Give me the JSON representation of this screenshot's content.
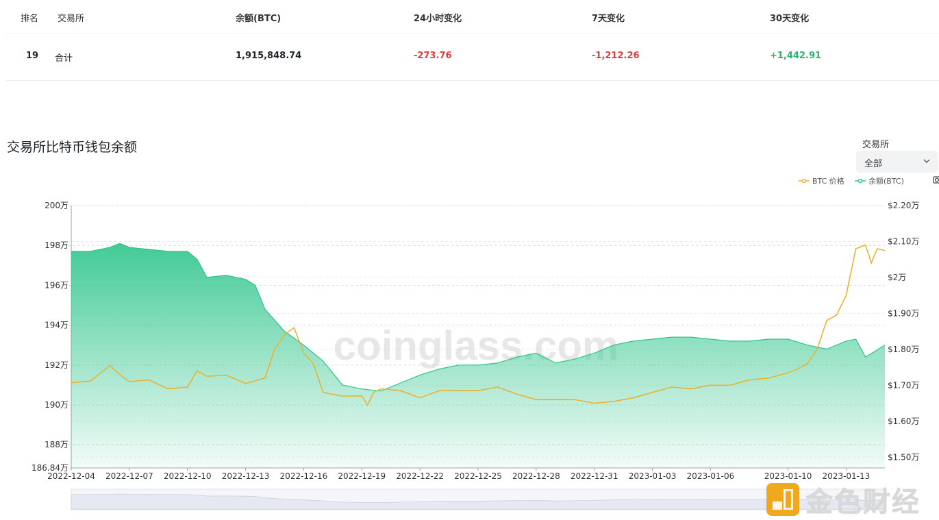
{
  "table": {
    "headers": {
      "rank": "排名",
      "exchange": "交易所",
      "balance": "余额(BTC)",
      "change_24h": "24小时变化",
      "change_7d": "7天变化",
      "change_30d": "30天变化"
    },
    "row": {
      "rank": "19",
      "exchange": "合计",
      "balance": "1,915,848.74",
      "change_24h": "-273.76",
      "change_7d": "-1,212.26",
      "change_30d": "+1,442.91"
    }
  },
  "chart_title": "交易所比特币钱包余额",
  "filter": {
    "label": "交易所",
    "selected": "全部"
  },
  "watermark": "coinglass.com",
  "brand": "金色财经",
  "colors": {
    "balance": "#2dc38a",
    "price": "#e9b234",
    "negative": "#e23c3c",
    "positive": "#2ab36a"
  },
  "icons": {
    "select": "chevron-down-icon",
    "toolbar": "camera-icon",
    "brand": "brand-logo-icon"
  },
  "chart_data": {
    "type": "area",
    "x_tick_labels": [
      "2022-12-04",
      "2022-12-07",
      "2022-12-10",
      "2022-12-13",
      "2022-12-16",
      "2022-12-19",
      "2022-12-22",
      "2022-12-25",
      "2022-12-28",
      "2022-12-31",
      "2023-01-03",
      "2023-01-06",
      "2023-01-10",
      "2023-01-13"
    ],
    "x_range": [
      "2022-12-04",
      "2023-01-15"
    ],
    "left_axis": {
      "ticks": [
        "200万",
        "198万",
        "196万",
        "194万",
        "192万",
        "190万",
        "188万",
        "186.84万"
      ],
      "min_wan": 186.84,
      "max_wan": 200
    },
    "right_axis": {
      "ticks": [
        "$2.20万",
        "$2.10万",
        "$2万",
        "$1.90万",
        "$1.80万",
        "$1.70万",
        "$1.60万",
        "$1.50万"
      ],
      "min_wan": 1.47,
      "max_wan": 2.2
    },
    "grid": true,
    "legend_position": "top-right",
    "series": [
      {
        "name": "BTC 价格",
        "axis": "right",
        "units": "万 USD",
        "points": [
          [
            "2022-12-04",
            1.707
          ],
          [
            "2022-12-05",
            1.712
          ],
          [
            "2022-12-06",
            1.755
          ],
          [
            "2022-12-06.5",
            1.73
          ],
          [
            "2022-12-07",
            1.71
          ],
          [
            "2022-12-08",
            1.715
          ],
          [
            "2022-12-09",
            1.69
          ],
          [
            "2022-12-10",
            1.695
          ],
          [
            "2022-12-10.5",
            1.74
          ],
          [
            "2022-12-11",
            1.725
          ],
          [
            "2022-12-12",
            1.728
          ],
          [
            "2022-12-13",
            1.705
          ],
          [
            "2022-12-14",
            1.72
          ],
          [
            "2022-12-14.5",
            1.8
          ],
          [
            "2022-12-15",
            1.84
          ],
          [
            "2022-12-15.5",
            1.86
          ],
          [
            "2022-12-16",
            1.79
          ],
          [
            "2022-12-16.5",
            1.76
          ],
          [
            "2022-12-17",
            1.68
          ],
          [
            "2022-12-18",
            1.67
          ],
          [
            "2022-12-19",
            1.67
          ],
          [
            "2022-12-19.3",
            1.645
          ],
          [
            "2022-12-19.6",
            1.68
          ],
          [
            "2022-12-20",
            1.69
          ],
          [
            "2022-12-21",
            1.685
          ],
          [
            "2022-12-22",
            1.665
          ],
          [
            "2022-12-23",
            1.685
          ],
          [
            "2022-12-25",
            1.685
          ],
          [
            "2022-12-26",
            1.695
          ],
          [
            "2022-12-27",
            1.675
          ],
          [
            "2022-12-28",
            1.66
          ],
          [
            "2022-12-29",
            1.66
          ],
          [
            "2022-12-30",
            1.66
          ],
          [
            "2022-12-31",
            1.65
          ],
          [
            "2023-01-01",
            1.655
          ],
          [
            "2023-01-02",
            1.665
          ],
          [
            "2023-01-03",
            1.68
          ],
          [
            "2023-01-04",
            1.695
          ],
          [
            "2023-01-05",
            1.69
          ],
          [
            "2023-01-06",
            1.7
          ],
          [
            "2023-01-07",
            1.7
          ],
          [
            "2023-01-08",
            1.715
          ],
          [
            "2023-01-09",
            1.72
          ],
          [
            "2023-01-10",
            1.735
          ],
          [
            "2023-01-10.5",
            1.745
          ],
          [
            "2023-01-11",
            1.76
          ],
          [
            "2023-01-11.5",
            1.8
          ],
          [
            "2023-01-12",
            1.88
          ],
          [
            "2023-01-12.5",
            1.895
          ],
          [
            "2023-01-13",
            1.95
          ],
          [
            "2023-01-13.5",
            2.08
          ],
          [
            "2023-01-14",
            2.09
          ],
          [
            "2023-01-14.3",
            2.04
          ],
          [
            "2023-01-14.6",
            2.08
          ],
          [
            "2023-01-15",
            2.075
          ]
        ]
      },
      {
        "name": "余额(BTC)",
        "axis": "left",
        "units": "万 BTC",
        "points": [
          [
            "2022-12-04",
            197.7
          ],
          [
            "2022-12-05",
            197.7
          ],
          [
            "2022-12-06",
            197.9
          ],
          [
            "2022-12-06.5",
            198.1
          ],
          [
            "2022-12-07",
            197.9
          ],
          [
            "2022-12-08",
            197.8
          ],
          [
            "2022-12-09",
            197.7
          ],
          [
            "2022-12-10",
            197.7
          ],
          [
            "2022-12-10.5",
            197.3
          ],
          [
            "2022-12-11",
            196.4
          ],
          [
            "2022-12-12",
            196.5
          ],
          [
            "2022-12-13",
            196.3
          ],
          [
            "2022-12-13.5",
            196.0
          ],
          [
            "2022-12-14",
            194.8
          ],
          [
            "2022-12-15",
            193.7
          ],
          [
            "2022-12-16",
            193.0
          ],
          [
            "2022-12-17",
            192.2
          ],
          [
            "2022-12-18",
            191.0
          ],
          [
            "2022-12-19",
            190.8
          ],
          [
            "2022-12-20",
            190.7
          ],
          [
            "2022-12-21",
            191.1
          ],
          [
            "2022-12-22",
            191.5
          ],
          [
            "2022-12-23",
            191.8
          ],
          [
            "2022-12-24",
            192.0
          ],
          [
            "2022-12-25",
            192.0
          ],
          [
            "2022-12-26",
            192.1
          ],
          [
            "2022-12-27",
            192.4
          ],
          [
            "2022-12-28",
            192.6
          ],
          [
            "2022-12-29",
            192.1
          ],
          [
            "2022-12-30",
            192.3
          ],
          [
            "2022-12-31",
            192.6
          ],
          [
            "2023-01-01",
            193.0
          ],
          [
            "2023-01-02",
            193.2
          ],
          [
            "2023-01-03",
            193.3
          ],
          [
            "2023-01-04",
            193.4
          ],
          [
            "2023-01-05",
            193.4
          ],
          [
            "2023-01-06",
            193.3
          ],
          [
            "2023-01-07",
            193.2
          ],
          [
            "2023-01-08",
            193.2
          ],
          [
            "2023-01-09",
            193.3
          ],
          [
            "2023-01-10",
            193.3
          ],
          [
            "2023-01-11",
            193.0
          ],
          [
            "2023-01-12",
            192.8
          ],
          [
            "2023-01-13",
            193.2
          ],
          [
            "2023-01-13.5",
            193.3
          ],
          [
            "2023-01-14",
            192.4
          ],
          [
            "2023-01-14.5",
            192.7
          ],
          [
            "2023-01-15",
            193.0
          ]
        ]
      }
    ]
  }
}
